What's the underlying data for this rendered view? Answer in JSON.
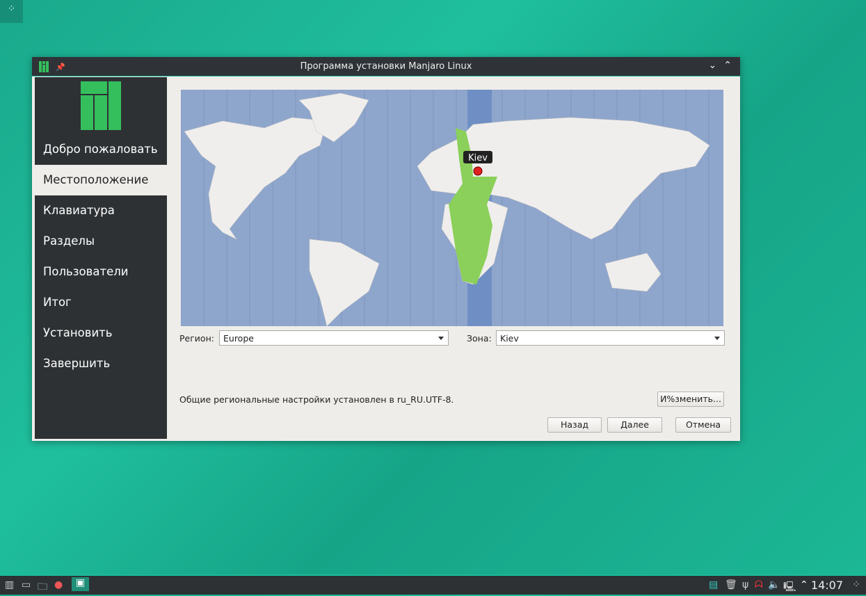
{
  "window": {
    "title": "Программа установки Manjaro Linux"
  },
  "sidebar": {
    "items": [
      {
        "label": "Добро пожаловать"
      },
      {
        "label": "Местоположение",
        "selected": true
      },
      {
        "label": "Клавиатура"
      },
      {
        "label": "Разделы"
      },
      {
        "label": "Пользователи"
      },
      {
        "label": "Итог"
      },
      {
        "label": "Установить"
      },
      {
        "label": "Завершить"
      }
    ]
  },
  "map": {
    "pin_label": "Kiev",
    "colors": {
      "ocean": "#8fa6cc",
      "land": "#f0eeec",
      "selected_zone": "#8bd05a",
      "selected_band": "#6f8fc4",
      "pin": "#e02020"
    }
  },
  "location": {
    "region_label": "Регион:",
    "region_value": "Europe",
    "zone_label": "Зона:",
    "zone_value": "Kiev"
  },
  "locale": {
    "text": "Общие региональные настройки установлен в ru_RU.UTF-8.",
    "change_button": "И%зменить..."
  },
  "buttons": {
    "back": "Назад",
    "next": "Далее",
    "cancel": "Отмена"
  },
  "taskbar": {
    "clock": "14:07"
  },
  "colors": {
    "accent": "#1abc9c",
    "sidebar": "#2d3134"
  }
}
